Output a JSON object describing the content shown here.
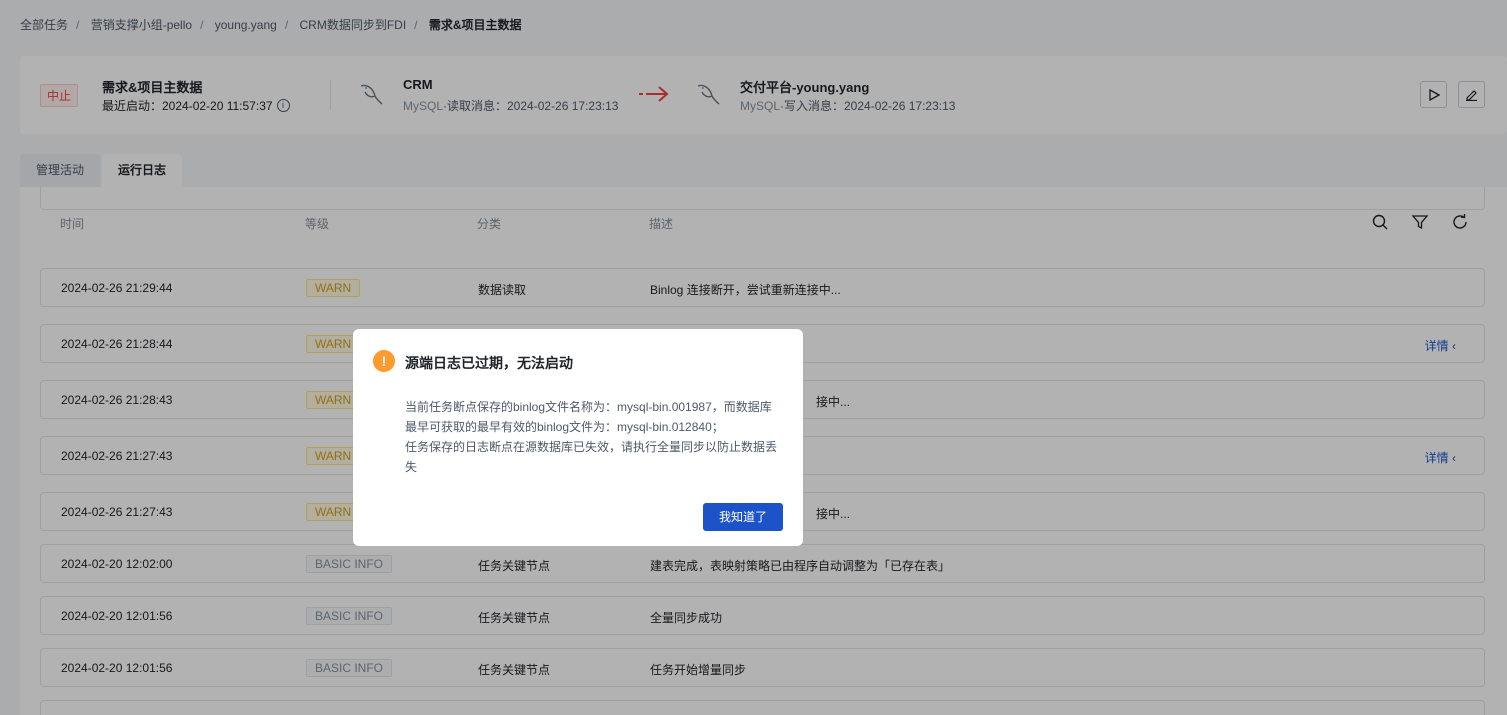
{
  "breadcrumb": [
    "全部任务",
    "营销支撑小组-pello",
    "young.yang",
    "CRM数据同步到FDI",
    "需求&项目主数据"
  ],
  "task": {
    "status": "中止",
    "name": "需求&项目主数据",
    "start_label": "最近启动：2024-02-20 11:57:37",
    "source": {
      "name": "CRM",
      "type": "MySQL",
      "info": "·读取消息：2024-02-26 17:23:13"
    },
    "target": {
      "name": "交付平台-young.yang",
      "type": "MySQL",
      "info": "·写入消息：2024-02-26 17:23:13"
    }
  },
  "tabs": [
    {
      "label": "管理活动",
      "active": false
    },
    {
      "label": "运行日志",
      "active": true
    }
  ],
  "log_table": {
    "columns": [
      "时间",
      "等级",
      "分类",
      "描述"
    ],
    "rows": [
      {
        "time": "2024-02-26 21:29:44",
        "level": "WARN",
        "category": "数据读取",
        "desc": "Binlog 连接断开，尝试重新连接中...",
        "detail": ""
      },
      {
        "time": "2024-02-26 21:28:44",
        "level": "WARN",
        "category": "",
        "desc": "",
        "detail": "详情"
      },
      {
        "time": "2024-02-26 21:28:43",
        "level": "WARN",
        "category": "",
        "desc": "接中...",
        "detail": ""
      },
      {
        "time": "2024-02-26 21:27:43",
        "level": "WARN",
        "category": "",
        "desc": "",
        "detail": "详情"
      },
      {
        "time": "2024-02-26 21:27:43",
        "level": "WARN",
        "category": "",
        "desc": "接中...",
        "detail": ""
      },
      {
        "time": "2024-02-20 12:02:00",
        "level": "BASIC INFO",
        "category": "任务关键节点",
        "desc": "建表完成，表映射策略已由程序自动调整为「已存在表」",
        "detail": ""
      },
      {
        "time": "2024-02-20 12:01:56",
        "level": "BASIC INFO",
        "category": "任务关键节点",
        "desc": "全量同步成功",
        "detail": ""
      },
      {
        "time": "2024-02-20 12:01:56",
        "level": "BASIC INFO",
        "category": "任务关键节点",
        "desc": "任务开始增量同步",
        "detail": ""
      }
    ]
  },
  "modal": {
    "title": "源端日志已过期，无法启动",
    "lines": [
      "当前任务断点保存的binlog文件名称为：mysql-bin.001987，而数据库最早可获取的最早有效的binlog文件为：mysql-bin.012840；",
      "任务保存的日志断点在源数据库已失效，请执行全量同步以防止数据丢失"
    ],
    "ok_label": "我知道了"
  },
  "icons": {
    "info": "info-circle-icon",
    "database": "mysql-dolphin-icon",
    "arrow": "arrow-right-icon",
    "run": "play-icon",
    "edit": "edit-icon",
    "search": "search-icon",
    "filter": "filter-icon",
    "refresh": "refresh-icon",
    "warning": "warning-icon"
  },
  "colors": {
    "primary": "#1d53c8",
    "danger": "#f53f3f",
    "warn": "#d4a017",
    "modal_icon": "#ff9a2e"
  }
}
